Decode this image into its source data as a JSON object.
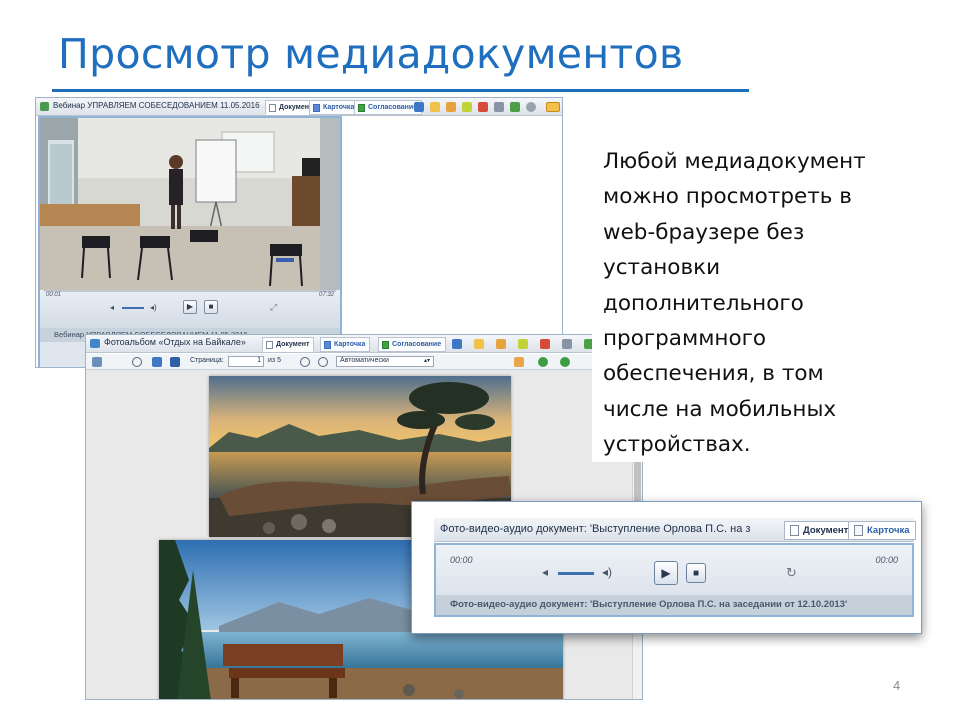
{
  "slide": {
    "title": "Просмотр медиадокументов",
    "body_lines": [
      "Любой медиадокумент",
      "можно просмотреть в",
      "web-браузере без",
      "установки",
      "дополнительного",
      "программного",
      "обеспечения, в том",
      "числе на мобильных",
      "устройствах."
    ],
    "page_number": "4",
    "accent_color": "#1f6fbe"
  },
  "video_window": {
    "title": "Вебинар УПРАВЛЯЕМ СОБЕСЕДОВАНИЕМ 11.05.2016",
    "tabs": [
      "Документ",
      "Карточка",
      "Согласование"
    ],
    "time_start": "00:01",
    "time_end": "07:32",
    "caption": "Вебинар УПРАВЛЯЕМ СОБЕСЕДОВАНИЕМ 11.05.2016"
  },
  "photo_window": {
    "title": "Фотоальбом «Отдых на Байкале»",
    "tabs": [
      "Документ",
      "Карточка",
      "Согласование"
    ],
    "page_label": "Страница:",
    "page_value": "1",
    "page_total": "из 5",
    "zoom_value": "Автоматически"
  },
  "audio_window": {
    "title": "Фото-видео-аудио документ: 'Выступление Орлова П.С. на з",
    "tabs": [
      "Документ",
      "Карточка"
    ],
    "time_start": "00:00",
    "time_end": "00:00",
    "caption": "Фото-видео-аудио документ: 'Выступление Орлова П.С. на заседании от 12.10.2013'"
  }
}
